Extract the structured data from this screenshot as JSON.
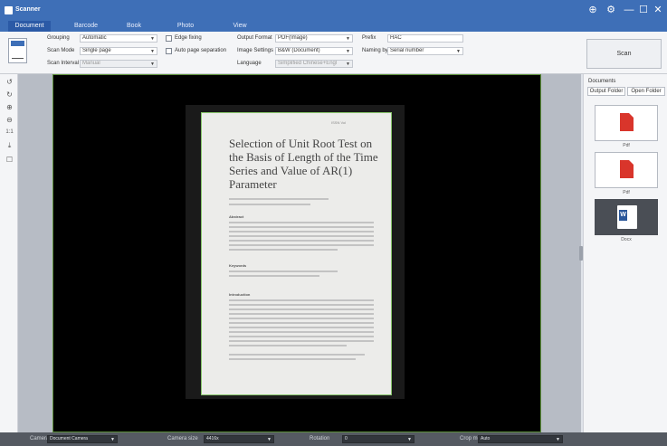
{
  "app": {
    "title": "Scanner"
  },
  "window_controls": {
    "globe": "⊕",
    "settings": "⚙",
    "minimize": "—",
    "maximize": "☐",
    "close": "✕"
  },
  "tabs": [
    {
      "label": "Document",
      "active": true
    },
    {
      "label": "Barcode"
    },
    {
      "label": "Book"
    },
    {
      "label": "Photo"
    },
    {
      "label": "View"
    }
  ],
  "toolbar": {
    "grouping_label": "Grouping",
    "grouping_value": "Automatic",
    "mode_label": "Scan Mode",
    "mode_value": "Single page",
    "interval_label": "Scan Interval",
    "interval_value": "Manual",
    "edge_fixing_label": "Edge fixing",
    "auto_page_label": "Auto page separation",
    "output_format_label": "Output Format",
    "output_format_value": "PDF(Image)",
    "image_settings_label": "Image Settings",
    "image_settings_value": "B&W (Document)",
    "language_label": "Language",
    "language_value": "Simplified Chinese+Engl",
    "prefix_label": "Prefix",
    "prefix_value": "HAC",
    "naming_label": "Naming by",
    "naming_value": "Serial number",
    "scan_button": "Scan"
  },
  "left_tools": [
    "↺",
    "↻",
    "⊕",
    "⊖",
    "1:1",
    "⤓",
    "☐"
  ],
  "document_page": {
    "header": "ISSN   Vol",
    "title": "Selection of Unit Root Test on the Basis of Length of the Time Series and Value of AR(1) Parameter",
    "section_abstract": "Abstract",
    "section_keywords": "Keywords",
    "section_intro": "Introduction"
  },
  "right_panel": {
    "title": "Documents",
    "output_folder_button": "Output Folder",
    "open_folder_button": "Open Folder",
    "files": [
      {
        "label": "Pdf",
        "type": "pdf"
      },
      {
        "label": "Pdf",
        "type": "pdf"
      },
      {
        "label": "Docx",
        "type": "word"
      }
    ]
  },
  "status_bar": {
    "camera_label": "Camera",
    "camera_value": "Document Camera",
    "resolution_label": "Camera size",
    "resolution_value": "4416x",
    "rotation_label": "Rotation",
    "rotation_value": "0",
    "crop_label": "Crop mode",
    "crop_value": "Auto",
    "exposure_label": "Exposure",
    "exposure_value": "-"
  }
}
